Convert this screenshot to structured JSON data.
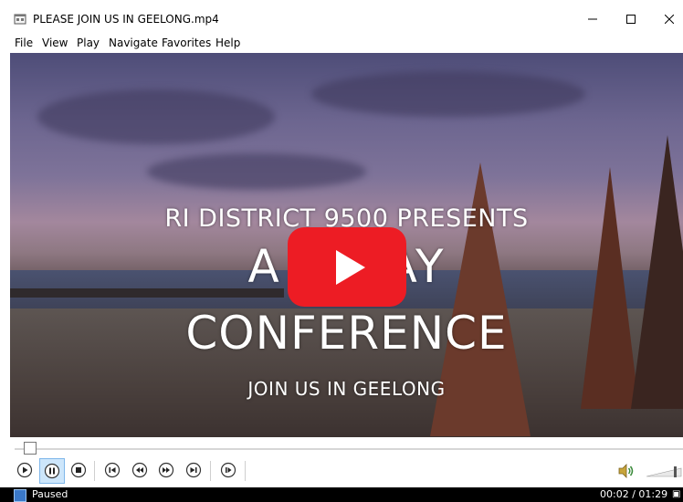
{
  "window": {
    "title": "PLEASE JOIN US IN GEELONG.mp4",
    "minimize_glyph": "—",
    "maximize_glyph": "☐",
    "close_glyph": "✕"
  },
  "menu": {
    "items": [
      {
        "label": "File"
      },
      {
        "label": "View"
      },
      {
        "label": "Play"
      },
      {
        "label": "Navigate"
      },
      {
        "label": "Favorites"
      },
      {
        "label": "Help"
      }
    ]
  },
  "video": {
    "line1": "RI DISTRICT 9500 PRESENTS",
    "line2": "A H    DAY",
    "line3": "CONFERENCE",
    "line4": "JOIN US IN GEELONG",
    "play_button_color": "#ed1c24"
  },
  "playback": {
    "state": "Paused",
    "current_time": "00:02",
    "total_time": "01:29",
    "time_display": "00:02 / 01:29",
    "progress": 0.022
  },
  "controls": {
    "buttons": [
      {
        "name": "play-button",
        "icon": "play-icon"
      },
      {
        "name": "pause-button",
        "icon": "pause-icon",
        "pressed": true
      },
      {
        "name": "stop-button",
        "icon": "stop-icon"
      },
      {
        "name": "previous-button",
        "icon": "skip-back-icon"
      },
      {
        "name": "rewind-button",
        "icon": "rewind-icon"
      },
      {
        "name": "fast-forward-button",
        "icon": "fast-forward-icon"
      },
      {
        "name": "next-button",
        "icon": "skip-forward-icon"
      },
      {
        "name": "frame-step-button",
        "icon": "frame-step-icon"
      }
    ]
  },
  "colors": {
    "accent_pressed": "#cde6fb",
    "status_bar": "#000000"
  }
}
